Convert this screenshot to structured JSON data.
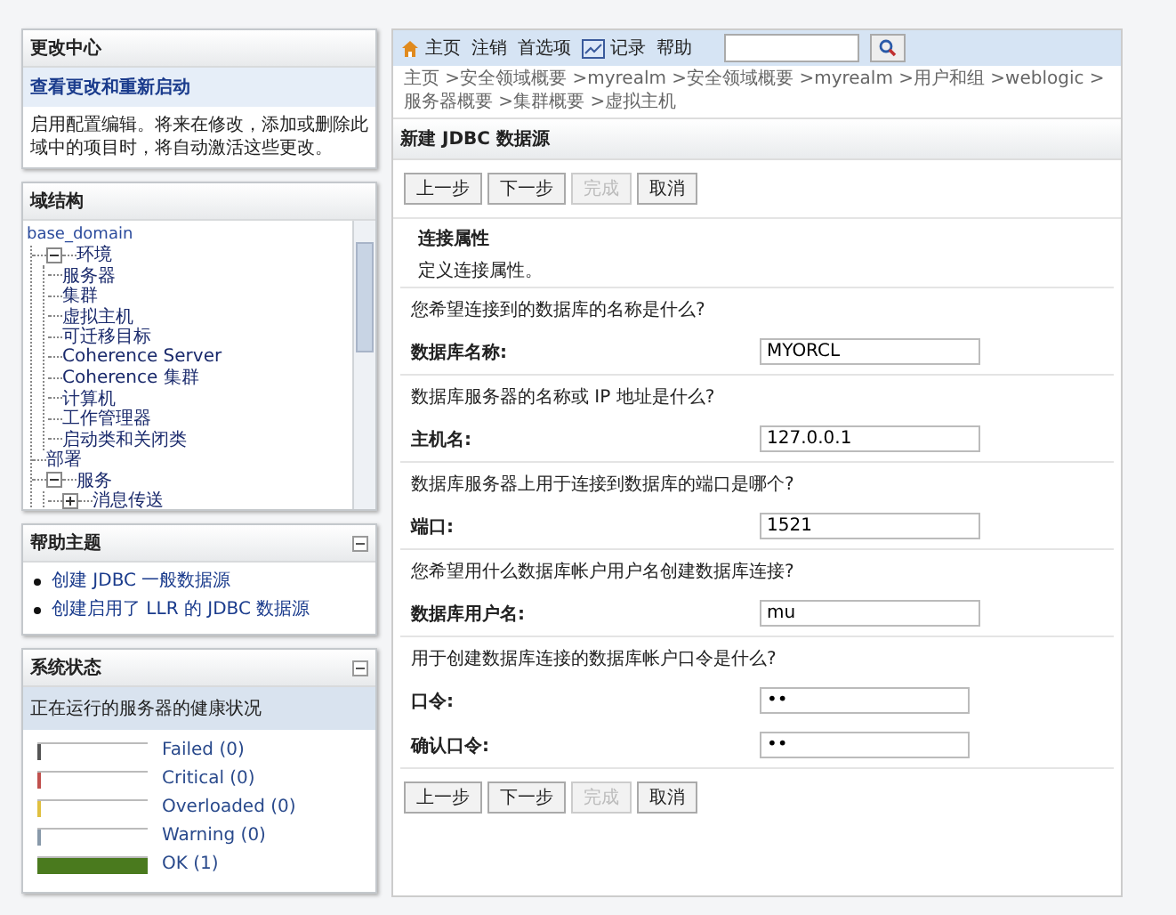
{
  "change_center": {
    "title": "更改中心",
    "link": "查看更改和重新启动",
    "text": "启用配置编辑。将来在修改，添加或删除此域中的项目时，将自动激活这些更改。"
  },
  "domain_structure": {
    "title": "域结构",
    "tree": [
      {
        "label": "base_domain",
        "children": [
          {
            "label": "环境",
            "expanded": true,
            "children": [
              {
                "label": "服务器"
              },
              {
                "label": "集群"
              },
              {
                "label": "虚拟主机"
              },
              {
                "label": "可迁移目标"
              },
              {
                "label": "Coherence Server"
              },
              {
                "label": "Coherence 集群"
              },
              {
                "label": "计算机"
              },
              {
                "label": "工作管理器"
              },
              {
                "label": "启动类和关闭类"
              }
            ]
          },
          {
            "label": "部署"
          },
          {
            "label": "服务",
            "expanded": true,
            "children": [
              {
                "label": "消息传送",
                "expanded": false
              }
            ]
          }
        ]
      }
    ]
  },
  "help_topics": {
    "title": "帮助主题",
    "links": [
      "创建 JDBC 一般数据源",
      "创建启用了 LLR 的 JDBC 数据源"
    ]
  },
  "system_status": {
    "title": "系统状态",
    "subtitle": "正在运行的服务器的健康状况",
    "rows": [
      {
        "label": "Failed (0)",
        "level": 0,
        "color": "#555555"
      },
      {
        "label": "Critical (0)",
        "level": 0,
        "color": "#c0504d"
      },
      {
        "label": "Overloaded (0)",
        "level": 0,
        "color": "#e0c040"
      },
      {
        "label": "Warning (0)",
        "level": 0,
        "color": "#8899aa"
      },
      {
        "label": "OK (1)",
        "level": 1,
        "color": "#4a7a1e"
      }
    ]
  },
  "toolbar": {
    "links": [
      {
        "label": "主页",
        "kind": "home"
      },
      {
        "label": "注销",
        "kind": "plain"
      },
      {
        "label": "首选项",
        "kind": "plain"
      },
      {
        "label": "记录",
        "kind": "log"
      },
      {
        "label": "帮助",
        "kind": "plain"
      }
    ]
  },
  "breadcrumb": "主页 >安全领域概要 >myrealm >安全领域概要 >myrealm >用户和组 >weblogic >服务器概要 >集群概要 >虚拟主机",
  "page_title": "新建 JDBC 数据源",
  "buttons": [
    {
      "label": "上一步",
      "disabled": false
    },
    {
      "label": "下一步",
      "disabled": false
    },
    {
      "label": "完成",
      "disabled": true
    },
    {
      "label": "取消",
      "disabled": false
    }
  ],
  "section": {
    "title": "连接属性",
    "description": "定义连接属性。"
  },
  "groups": [
    {
      "question": "您希望连接到的数据库的名称是什么?",
      "fields": [
        {
          "label": "数据库名称:",
          "value": "MYORCL"
        }
      ]
    },
    {
      "question": "数据库服务器的名称或 IP 地址是什么?",
      "fields": [
        {
          "label": "主机名:",
          "value": "127.0.0.1"
        }
      ]
    },
    {
      "question": "数据库服务器上用于连接到数据库的端口是哪个?",
      "fields": [
        {
          "label": "端口:",
          "value": "1521"
        }
      ]
    },
    {
      "question": "您希望用什么数据库帐户用户名创建数据库连接?",
      "fields": [
        {
          "label": "数据库用户名:",
          "value": "mu"
        }
      ]
    },
    {
      "question": "用于创建数据库连接的数据库帐户口令是什么?",
      "fields": [
        {
          "label": "口令:",
          "value": "••",
          "kind": "password"
        },
        {
          "label": "确认口令:",
          "value": "••",
          "kind": "password"
        }
      ]
    }
  ],
  "bottom_buttons": [
    {
      "label": "上一步",
      "disabled": false
    },
    {
      "label": "下一步",
      "disabled": false
    },
    {
      "label": "完成",
      "disabled": true
    },
    {
      "label": "取消",
      "disabled": false
    }
  ]
}
